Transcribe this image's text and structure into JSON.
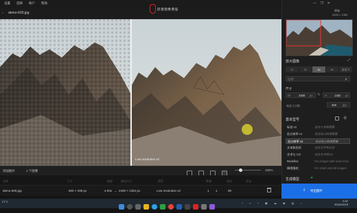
{
  "menu": [
    "设置",
    "选择",
    "帐户",
    "帮助"
  ],
  "app": {
    "name": "舒意图像增强",
    "filename": "demo-600.jpg"
  },
  "window_controls": [
    "—",
    "❐",
    "✕"
  ],
  "preview": {
    "label": "Low resolution v2"
  },
  "toolbar": {
    "add_label": "添加图片",
    "count_label": "1 个图像",
    "zoom": "100%"
  },
  "list": {
    "headers": [
      "名称",
      "尺寸",
      "缩放",
      "输出尺寸",
      "模型",
      "降噪",
      "锐化",
      "状态"
    ],
    "row": {
      "name": "demo-600.jpg",
      "size": "600 × 338 px",
      "scale": "4.00x",
      "arrow": "→",
      "out": "2400 × 1352 px",
      "model": "Low resolution v2",
      "a": "1",
      "b": "1",
      "c": "90"
    }
  },
  "panel": {
    "thumb_caption": "原始",
    "thumb_size": "2400 × 1352",
    "upscale_title": "放大图像",
    "scale_options": [
      "1x",
      "2x",
      "4x",
      "6x",
      "自定义"
    ],
    "scale_selected": 2,
    "scale_value_label": "比例",
    "scale_value": "4",
    "size_title": "尺寸",
    "width_label": "W",
    "width_value": "2400",
    "height_label": "H",
    "height_value": "1352",
    "unit": "px",
    "dpi_label": "每英寸点数",
    "dpi_value": "300",
    "dpi_unit": "ppi",
    "models_title": "基本型号",
    "models": [
      {
        "name": "标准 v2",
        "desc": "适合大多数图像"
      },
      {
        "name": "低分辨率 v1",
        "desc": "适合低分辨率图像"
      },
      {
        "name": "低分辨率 v2",
        "desc": "适合低分辨率图像"
      },
      {
        "name": "文本和形状",
        "desc": "适合文字和形状"
      },
      {
        "name": "艺术与 CG",
        "desc": "适合艺术和CG"
      },
      {
        "name": "Redefine",
        "desc": "For images with more lines"
      },
      {
        "name": "精细描绘",
        "desc": "For small and old images"
      }
    ],
    "model_selected": 2,
    "generate_header": "生成模型",
    "generate_button": "导出图片"
  },
  "taskbar": {
    "weather": "27°C",
    "time": "9:37",
    "date": "2024/10/15"
  },
  "colors": {
    "accent": "#1b6fe6",
    "brand": "#dd2222",
    "cursor": "#d5cc2f"
  }
}
